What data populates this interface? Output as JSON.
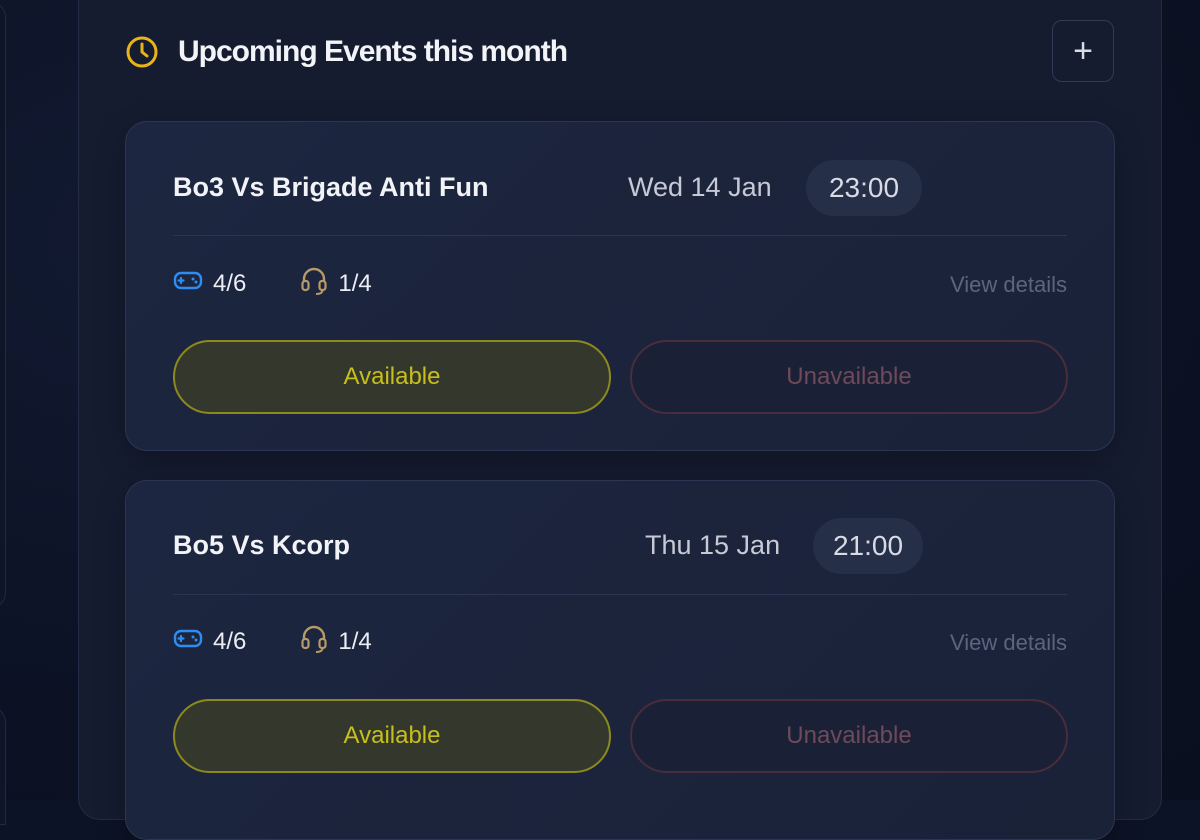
{
  "header": {
    "title": "Upcoming Events this month",
    "add_label": "+"
  },
  "accent_colors": {
    "clock": "#e8b418",
    "controller": "#2f8cf0",
    "headset": "#b89a68",
    "available": "#c7bf1c",
    "unavailable": "#6e4a5a"
  },
  "events": [
    {
      "name": "Bo3 Vs Brigade Anti Fun",
      "date": "Wed 14 Jan",
      "time": "23:00",
      "players": "4/6",
      "staff": "1/4",
      "view_details": "View details",
      "available_label": "Available",
      "unavailable_label": "Unavailable"
    },
    {
      "name": "Bo5 Vs Kcorp",
      "date": "Thu 15 Jan",
      "time": "21:00",
      "players": "4/6",
      "staff": "1/4",
      "view_details": "View details",
      "available_label": "Available",
      "unavailable_label": "Unavailable"
    }
  ]
}
